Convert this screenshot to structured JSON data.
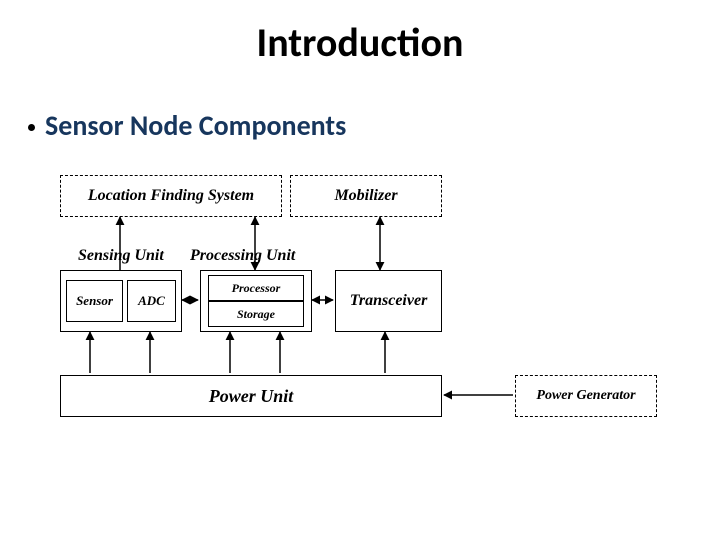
{
  "title": "Introduction",
  "bullet": "Sensor Node Components",
  "diagram": {
    "locationFinding": "Location Finding System",
    "mobilizer": "Mobilizer",
    "sensingUnit": "Sensing Unit",
    "processingUnit": "Processing Unit",
    "sensor": "Sensor",
    "adc": "ADC",
    "processor": "Processor",
    "storage": "Storage",
    "transceiver": "Transceiver",
    "powerUnit": "Power Unit",
    "powerGenerator": "Power Generator"
  }
}
